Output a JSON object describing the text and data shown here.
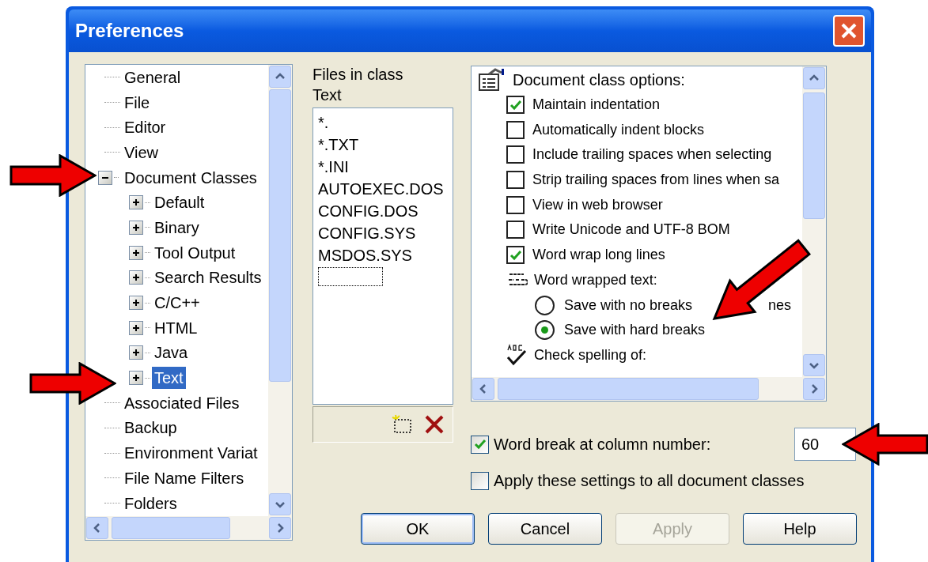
{
  "window": {
    "title": "Preferences"
  },
  "tree": {
    "items": [
      {
        "label": "General",
        "selected": false
      },
      {
        "label": "File",
        "selected": false
      },
      {
        "label": "Editor",
        "selected": false
      },
      {
        "label": "View",
        "selected": false
      },
      {
        "label": "Document Classes",
        "selected": false,
        "expanded": true,
        "children": [
          {
            "label": "Default",
            "selected": false,
            "expanded": false
          },
          {
            "label": "Binary",
            "selected": false,
            "expanded": false
          },
          {
            "label": "Tool Output",
            "selected": false,
            "expanded": false
          },
          {
            "label": "Search Results",
            "selected": false,
            "expanded": false
          },
          {
            "label": "C/C++",
            "selected": false,
            "expanded": false
          },
          {
            "label": "HTML",
            "selected": false,
            "expanded": false
          },
          {
            "label": "Java",
            "selected": false,
            "expanded": false
          },
          {
            "label": "Text",
            "selected": true,
            "expanded": false
          }
        ]
      },
      {
        "label": "Associated Files",
        "selected": false
      },
      {
        "label": "Backup",
        "selected": false
      },
      {
        "label": "Environment Variat",
        "selected": false
      },
      {
        "label": "File Name Filters",
        "selected": false
      },
      {
        "label": "Folders",
        "selected": false
      }
    ]
  },
  "files_panel": {
    "label": "Files in class Text",
    "files": [
      "*.",
      "*.TXT",
      "*.INI",
      "AUTOEXEC.DOS",
      "CONFIG.DOS",
      "CONFIG.SYS",
      "MSDOS.SYS"
    ]
  },
  "options": {
    "heading": "Document class options:",
    "items": [
      {
        "kind": "checkbox",
        "label": "Maintain indentation",
        "checked": true
      },
      {
        "kind": "checkbox",
        "label": "Automatically indent blocks",
        "checked": false
      },
      {
        "kind": "checkbox",
        "label": "Include trailing spaces when selecting",
        "checked": false
      },
      {
        "kind": "checkbox",
        "label": "Strip trailing spaces from lines when sa",
        "checked": false
      },
      {
        "kind": "checkbox",
        "label": "View in web browser",
        "checked": false
      },
      {
        "kind": "checkbox",
        "label": "Write Unicode and UTF-8 BOM",
        "checked": false
      },
      {
        "kind": "checkbox",
        "label": "Word wrap long lines",
        "checked": true
      },
      {
        "kind": "wrap_group",
        "label": "Word wrapped text:"
      },
      {
        "kind": "radio",
        "label": "Save with no breaks",
        "label_tail": "nes",
        "selected": false
      },
      {
        "kind": "radio",
        "label": "Save with hard breaks",
        "selected": true
      },
      {
        "kind": "spelling_group",
        "label": "Check spelling of:"
      }
    ]
  },
  "word_break": {
    "label": "Word break at column number:",
    "checked": true,
    "value": "60"
  },
  "apply_all": {
    "label": "Apply these settings to all document classes",
    "checked": false
  },
  "buttons": [
    {
      "label": "OK",
      "default": true,
      "disabled": false
    },
    {
      "label": "Cancel",
      "default": false,
      "disabled": false
    },
    {
      "label": "Apply",
      "default": false,
      "disabled": true
    },
    {
      "label": "Help",
      "default": false,
      "disabled": false
    }
  ]
}
